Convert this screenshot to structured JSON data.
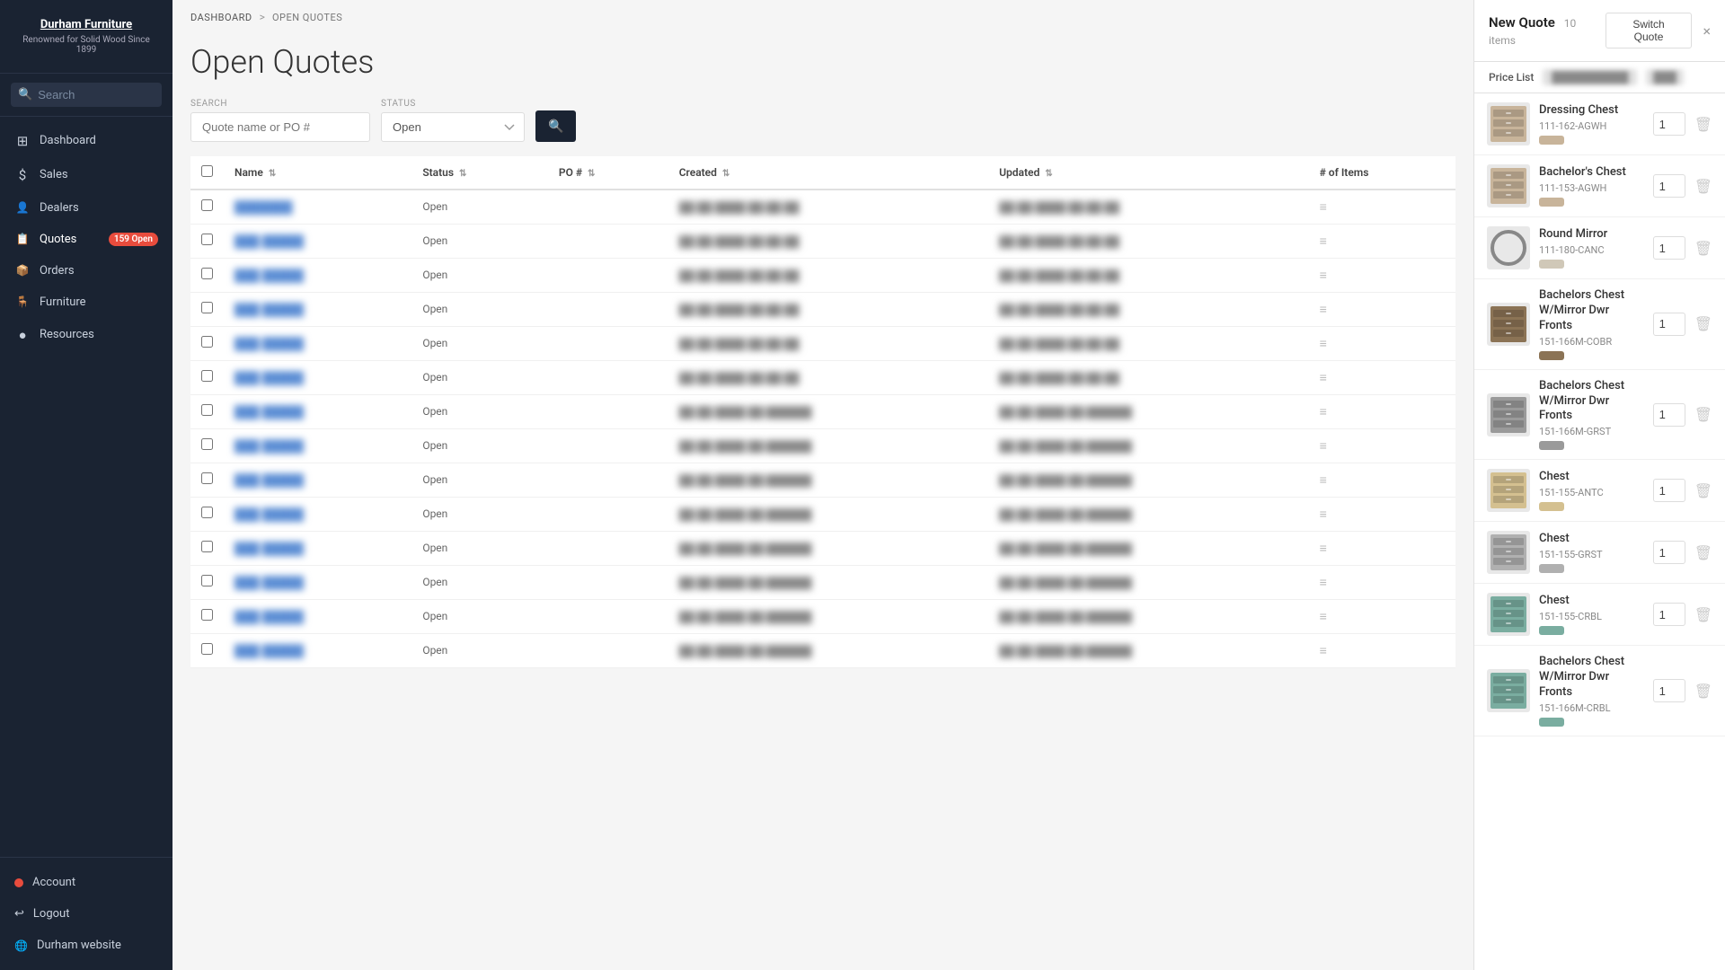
{
  "logo": {
    "title": "Durham Furniture",
    "subtitle": "Renowned for Solid Wood Since 1899"
  },
  "search": {
    "placeholder": "Search"
  },
  "nav": {
    "items": [
      {
        "id": "dashboard",
        "label": "Dashboard",
        "icon": "⊞",
        "active": false
      },
      {
        "id": "sales",
        "label": "Sales",
        "icon": "$",
        "active": false
      },
      {
        "id": "dealers",
        "label": "Dealers",
        "icon": "👥",
        "active": false
      },
      {
        "id": "quotes",
        "label": "Quotes",
        "icon": "📋",
        "active": true,
        "badge": "159 Open"
      },
      {
        "id": "orders",
        "label": "Orders",
        "icon": "📦",
        "active": false
      },
      {
        "id": "furniture",
        "label": "Furniture",
        "icon": "🪑",
        "active": false
      },
      {
        "id": "resources",
        "label": "Resources",
        "icon": "●",
        "active": false
      }
    ],
    "bottom": [
      {
        "id": "account",
        "label": "Account",
        "icon": "dot"
      },
      {
        "id": "logout",
        "label": "Logout",
        "icon": "↩"
      },
      {
        "id": "website",
        "label": "Durham website",
        "icon": "🌐"
      }
    ]
  },
  "breadcrumb": {
    "dashboard": "Dashboard",
    "separator": ">",
    "current": "Open Quotes"
  },
  "page": {
    "title": "Open Quotes"
  },
  "search_filter": {
    "search_label": "SEARCH",
    "search_placeholder": "Quote name or PO #",
    "status_label": "STATUS",
    "status_default": "Open"
  },
  "table": {
    "columns": [
      {
        "label": "Name",
        "sortable": true
      },
      {
        "label": "Status",
        "sortable": true
      },
      {
        "label": "PO #",
        "sortable": true
      },
      {
        "label": "Created",
        "sortable": true
      },
      {
        "label": "Updated",
        "sortable": true
      },
      {
        "label": "# of Items",
        "sortable": false
      }
    ],
    "rows": [
      {
        "name": "███████",
        "status": "Open",
        "po": "",
        "created": "██ ██ ████ ██:██:██",
        "updated": "██ ██ ████ ██:██:██",
        "items": ""
      },
      {
        "name": "███ █████",
        "status": "Open",
        "po": "",
        "created": "██ ██ ████ ██:██:██",
        "updated": "██ ██ ████ ██:██:██",
        "items": ""
      },
      {
        "name": "███ █████",
        "status": "Open",
        "po": "",
        "created": "██ ██ ████ ██:██:██",
        "updated": "██ ██ ████ ██:██:██",
        "items": ""
      },
      {
        "name": "███ █████",
        "status": "Open",
        "po": "",
        "created": "██ ██ ████ ██:██:██",
        "updated": "██ ██ ████ ██:██:██",
        "items": ""
      },
      {
        "name": "███ █████",
        "status": "Open",
        "po": "",
        "created": "██ ██ ████ ██:██:██",
        "updated": "██ ██ ████ ██:██:██",
        "items": ""
      },
      {
        "name": "███ █████",
        "status": "Open",
        "po": "",
        "created": "██ ██ ████ ██:██:██",
        "updated": "██ ██ ████ ██:██:██",
        "items": ""
      },
      {
        "name": "███ █████",
        "status": "Open",
        "po": "",
        "created": "██ ██ ████ ██:██████",
        "updated": "██ ██ ████ ██:██████",
        "items": ""
      },
      {
        "name": "███ █████",
        "status": "Open",
        "po": "",
        "created": "██ ██ ████ ██:██████",
        "updated": "██ ██ ████ ██:██████",
        "items": ""
      },
      {
        "name": "███ █████",
        "status": "Open",
        "po": "",
        "created": "██ ██ ████ ██:██████",
        "updated": "██ ██ ████ ██:██████",
        "items": ""
      },
      {
        "name": "███ █████",
        "status": "Open",
        "po": "",
        "created": "██ ██ ████ ██:██████",
        "updated": "██ ██ ████ ██:██████",
        "items": ""
      },
      {
        "name": "███ █████",
        "status": "Open",
        "po": "",
        "created": "██ ██ ████ ██:██████",
        "updated": "██ ██ ████ ██:██████",
        "items": ""
      },
      {
        "name": "███ █████",
        "status": "Open",
        "po": "",
        "created": "██ ██ ████ ██:██████",
        "updated": "██ ██ ████ ██:██████",
        "items": ""
      },
      {
        "name": "███ █████",
        "status": "Open",
        "po": "",
        "created": "██ ██ ████ ██:██████",
        "updated": "██ ██ ████ ██:██████",
        "items": ""
      },
      {
        "name": "███ █████",
        "status": "Open",
        "po": "",
        "created": "██ ██ ████ ██:██████",
        "updated": "██ ██ ████ ██:██████",
        "items": ""
      }
    ]
  },
  "panel": {
    "title": "New Quote",
    "item_count": "10 items",
    "switch_quote_btn": "Switch Quote",
    "close_btn": "×",
    "price_list_label": "Price List",
    "items": [
      {
        "name": "Dressing Chest",
        "sku": "111-162-AGWH",
        "color": "#c8b49a",
        "qty": 1,
        "img_type": "chest_light"
      },
      {
        "name": "Bachelor's Chest",
        "sku": "111-153-AGWH",
        "color": "#c8b49a",
        "qty": 1,
        "img_type": "chest_light"
      },
      {
        "name": "Round Mirror",
        "sku": "111-180-CANC",
        "color": "#d0c8b8",
        "qty": 1,
        "img_type": "mirror_round"
      },
      {
        "name": "Bachelors Chest W/Mirror Dwr Fronts",
        "sku": "151-166M-COBR",
        "color": "#8b7355",
        "qty": 1,
        "img_type": "chest_dark"
      },
      {
        "name": "Bachelors Chest W/Mirror Dwr Fronts",
        "sku": "151-166M-GRST",
        "color": "#9a9a9a",
        "qty": 1,
        "img_type": "chest_gray"
      },
      {
        "name": "Chest",
        "sku": "151-155-ANTC",
        "color": "#d4c090",
        "qty": 1,
        "img_type": "chest_tan"
      },
      {
        "name": "Chest",
        "sku": "151-155-GRST",
        "color": "#b0b0b0",
        "qty": 1,
        "img_type": "chest_gray2"
      },
      {
        "name": "Chest",
        "sku": "151-155-CRBL",
        "color": "#7aada0",
        "qty": 1,
        "img_type": "chest_teal"
      },
      {
        "name": "Bachelors Chest W/Mirror Dwr Fronts",
        "sku": "151-166M-CRBL",
        "color": "#7aada0",
        "qty": 1,
        "img_type": "chest_teal2"
      }
    ]
  }
}
